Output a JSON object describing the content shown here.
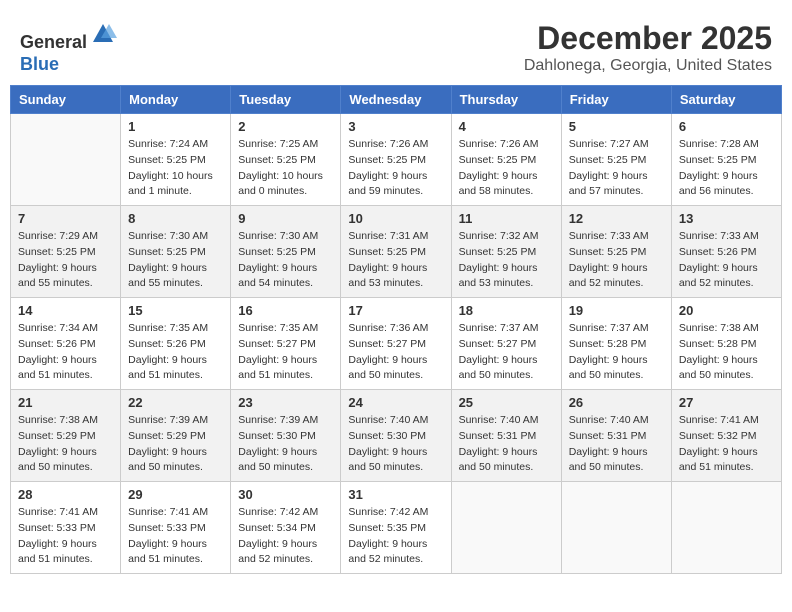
{
  "logo": {
    "general": "General",
    "blue": "Blue"
  },
  "title": "December 2025",
  "subtitle": "Dahlonega, Georgia, United States",
  "days_of_week": [
    "Sunday",
    "Monday",
    "Tuesday",
    "Wednesday",
    "Thursday",
    "Friday",
    "Saturday"
  ],
  "weeks": [
    [
      {
        "day": "",
        "info": ""
      },
      {
        "day": "1",
        "info": "Sunrise: 7:24 AM\nSunset: 5:25 PM\nDaylight: 10 hours\nand 1 minute."
      },
      {
        "day": "2",
        "info": "Sunrise: 7:25 AM\nSunset: 5:25 PM\nDaylight: 10 hours\nand 0 minutes."
      },
      {
        "day": "3",
        "info": "Sunrise: 7:26 AM\nSunset: 5:25 PM\nDaylight: 9 hours\nand 59 minutes."
      },
      {
        "day": "4",
        "info": "Sunrise: 7:26 AM\nSunset: 5:25 PM\nDaylight: 9 hours\nand 58 minutes."
      },
      {
        "day": "5",
        "info": "Sunrise: 7:27 AM\nSunset: 5:25 PM\nDaylight: 9 hours\nand 57 minutes."
      },
      {
        "day": "6",
        "info": "Sunrise: 7:28 AM\nSunset: 5:25 PM\nDaylight: 9 hours\nand 56 minutes."
      }
    ],
    [
      {
        "day": "7",
        "info": "Sunrise: 7:29 AM\nSunset: 5:25 PM\nDaylight: 9 hours\nand 55 minutes."
      },
      {
        "day": "8",
        "info": "Sunrise: 7:30 AM\nSunset: 5:25 PM\nDaylight: 9 hours\nand 55 minutes."
      },
      {
        "day": "9",
        "info": "Sunrise: 7:30 AM\nSunset: 5:25 PM\nDaylight: 9 hours\nand 54 minutes."
      },
      {
        "day": "10",
        "info": "Sunrise: 7:31 AM\nSunset: 5:25 PM\nDaylight: 9 hours\nand 53 minutes."
      },
      {
        "day": "11",
        "info": "Sunrise: 7:32 AM\nSunset: 5:25 PM\nDaylight: 9 hours\nand 53 minutes."
      },
      {
        "day": "12",
        "info": "Sunrise: 7:33 AM\nSunset: 5:25 PM\nDaylight: 9 hours\nand 52 minutes."
      },
      {
        "day": "13",
        "info": "Sunrise: 7:33 AM\nSunset: 5:26 PM\nDaylight: 9 hours\nand 52 minutes."
      }
    ],
    [
      {
        "day": "14",
        "info": "Sunrise: 7:34 AM\nSunset: 5:26 PM\nDaylight: 9 hours\nand 51 minutes."
      },
      {
        "day": "15",
        "info": "Sunrise: 7:35 AM\nSunset: 5:26 PM\nDaylight: 9 hours\nand 51 minutes."
      },
      {
        "day": "16",
        "info": "Sunrise: 7:35 AM\nSunset: 5:27 PM\nDaylight: 9 hours\nand 51 minutes."
      },
      {
        "day": "17",
        "info": "Sunrise: 7:36 AM\nSunset: 5:27 PM\nDaylight: 9 hours\nand 50 minutes."
      },
      {
        "day": "18",
        "info": "Sunrise: 7:37 AM\nSunset: 5:27 PM\nDaylight: 9 hours\nand 50 minutes."
      },
      {
        "day": "19",
        "info": "Sunrise: 7:37 AM\nSunset: 5:28 PM\nDaylight: 9 hours\nand 50 minutes."
      },
      {
        "day": "20",
        "info": "Sunrise: 7:38 AM\nSunset: 5:28 PM\nDaylight: 9 hours\nand 50 minutes."
      }
    ],
    [
      {
        "day": "21",
        "info": "Sunrise: 7:38 AM\nSunset: 5:29 PM\nDaylight: 9 hours\nand 50 minutes."
      },
      {
        "day": "22",
        "info": "Sunrise: 7:39 AM\nSunset: 5:29 PM\nDaylight: 9 hours\nand 50 minutes."
      },
      {
        "day": "23",
        "info": "Sunrise: 7:39 AM\nSunset: 5:30 PM\nDaylight: 9 hours\nand 50 minutes."
      },
      {
        "day": "24",
        "info": "Sunrise: 7:40 AM\nSunset: 5:30 PM\nDaylight: 9 hours\nand 50 minutes."
      },
      {
        "day": "25",
        "info": "Sunrise: 7:40 AM\nSunset: 5:31 PM\nDaylight: 9 hours\nand 50 minutes."
      },
      {
        "day": "26",
        "info": "Sunrise: 7:40 AM\nSunset: 5:31 PM\nDaylight: 9 hours\nand 50 minutes."
      },
      {
        "day": "27",
        "info": "Sunrise: 7:41 AM\nSunset: 5:32 PM\nDaylight: 9 hours\nand 51 minutes."
      }
    ],
    [
      {
        "day": "28",
        "info": "Sunrise: 7:41 AM\nSunset: 5:33 PM\nDaylight: 9 hours\nand 51 minutes."
      },
      {
        "day": "29",
        "info": "Sunrise: 7:41 AM\nSunset: 5:33 PM\nDaylight: 9 hours\nand 51 minutes."
      },
      {
        "day": "30",
        "info": "Sunrise: 7:42 AM\nSunset: 5:34 PM\nDaylight: 9 hours\nand 52 minutes."
      },
      {
        "day": "31",
        "info": "Sunrise: 7:42 AM\nSunset: 5:35 PM\nDaylight: 9 hours\nand 52 minutes."
      },
      {
        "day": "",
        "info": ""
      },
      {
        "day": "",
        "info": ""
      },
      {
        "day": "",
        "info": ""
      }
    ]
  ]
}
